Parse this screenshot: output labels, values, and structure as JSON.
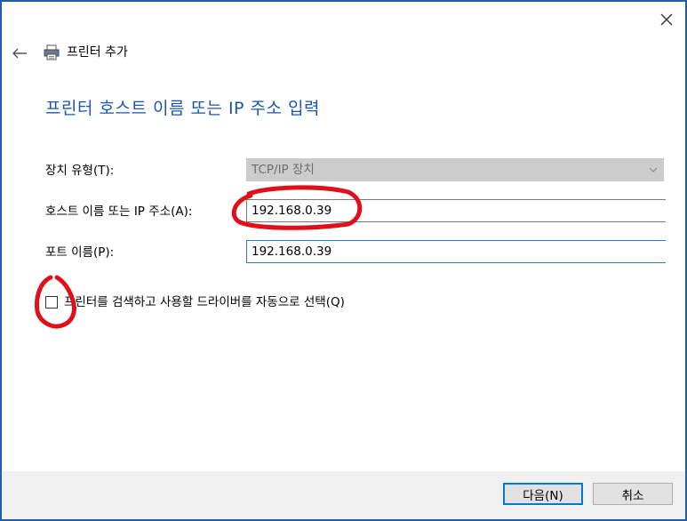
{
  "window": {
    "title": "프린터 추가"
  },
  "icons": {
    "close": "close-icon",
    "back": "back-arrow-icon",
    "printer": "printer-icon",
    "dropdown": "chevron-down-icon"
  },
  "page": {
    "heading": "프린터 호스트 이름 또는 IP 주소 입력"
  },
  "form": {
    "device_type_label": "장치 유형(T):",
    "device_type_value": "TCP/IP 장치",
    "host_label": "호스트 이름 또는 IP 주소(A):",
    "host_value": "192.168.0.39",
    "port_label": "포트 이름(P):",
    "port_value": "192.168.0.39",
    "auto_driver_label": "프린터를 검색하고 사용할 드라이버를 자동으로 선택(Q)",
    "auto_driver_checked": false
  },
  "buttons": {
    "next_label": "다음(N)",
    "cancel_label": "취소"
  },
  "colors": {
    "accent": "#1a55b0",
    "window_border": "#1f5fa8",
    "focus_border": "#2a78d6",
    "annotation_red": "#e0101a",
    "footer_bg": "#f0f0f0"
  }
}
